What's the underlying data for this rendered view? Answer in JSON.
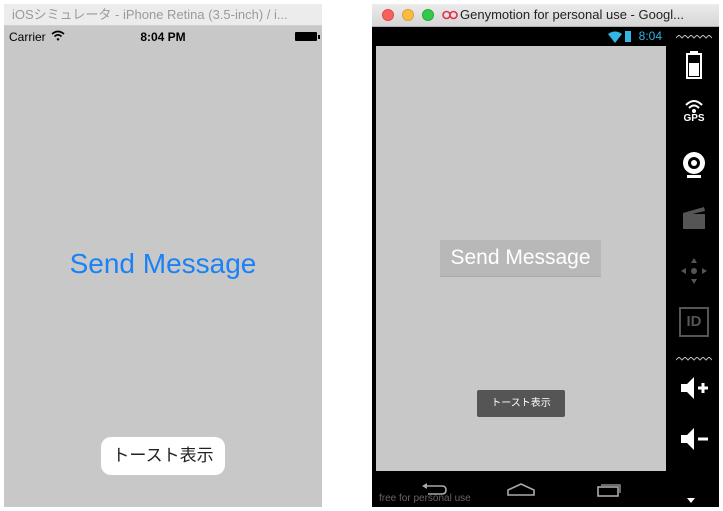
{
  "ios": {
    "window_title": "iOSシミュレータ - iPhone Retina (3.5-inch) / i...",
    "status": {
      "carrier": "Carrier",
      "time": "8:04 PM"
    },
    "send_label": "Send Message",
    "toast_label": "トースト表示"
  },
  "genymotion": {
    "window_title": "Genymotion for personal use - Googl...",
    "status_time": "8:04",
    "send_label": "Send Message",
    "toast_label": "トースト表示",
    "watermark": "free for personal use",
    "side_gps_label": "GPS",
    "side_id_label": "ID",
    "colors": {
      "accent": "#33b5e5"
    }
  },
  "icons": {
    "ios": [
      "wifi-icon",
      "battery-icon"
    ],
    "side": [
      "battery-icon",
      "gps-icon",
      "webcam-icon",
      "clapper-icon",
      "dpad-icon",
      "id-icon",
      "volume-up-icon",
      "volume-down-icon"
    ],
    "nav": [
      "back-icon",
      "home-icon",
      "recent-apps-icon"
    ]
  }
}
